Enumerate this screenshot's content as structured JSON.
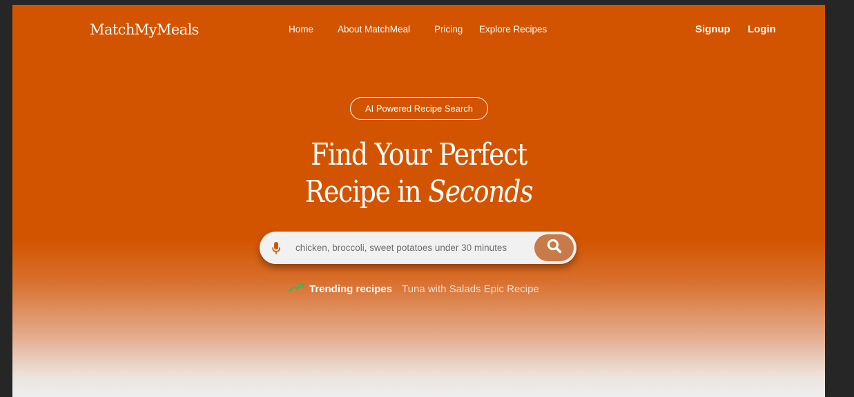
{
  "brand": {
    "logo": "MatchMyMeals"
  },
  "nav": {
    "links": [
      "Home",
      "About MatchMeal",
      "Pricing",
      "Explore Recipes"
    ],
    "signup": "Signup",
    "login": "Login"
  },
  "hero": {
    "badge": "AI Powered Recipe Search",
    "headline_line1": "Find Your Perfect",
    "headline_line2_prefix": "Recipe in ",
    "headline_line2_emphasis": "Seconds"
  },
  "search": {
    "placeholder": "chicken, broccoli, sweet potatoes under 30 minutes",
    "value": "",
    "mic_icon": "microphone-icon",
    "button_icon": "search-icon"
  },
  "trending": {
    "icon": "trending-up-icon",
    "label": "Trending recipes",
    "items": [
      "Tuna with Salads Epic Recipe"
    ]
  },
  "colors": {
    "primary": "#d35400",
    "search_button": "#c97a49",
    "trend_icon": "#4caf50",
    "page_background": "#262626"
  }
}
